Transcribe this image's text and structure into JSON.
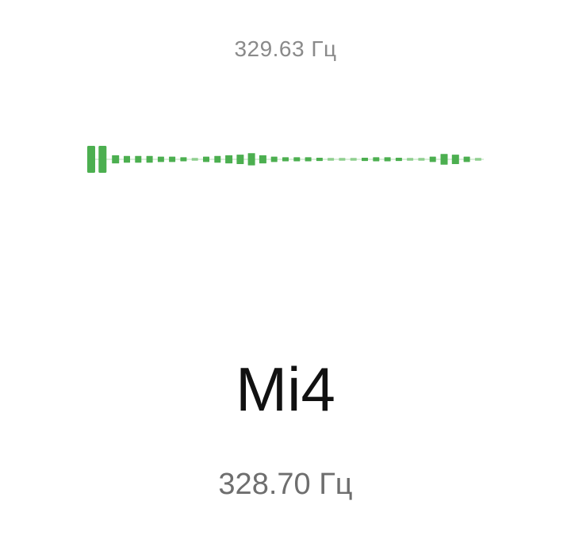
{
  "tuner": {
    "target_frequency": "329.63 Гц",
    "note": "Mi4",
    "detected_frequency": "328.70 Гц"
  },
  "meter": {
    "accent_color": "#4caf50",
    "pale_color": "#cfe8cf",
    "icon": "tuning-needle-bar-meter",
    "bars": [
      {
        "level": 1.0
      },
      {
        "level": 1.0
      },
      {
        "level": 0.3
      },
      {
        "level": 0.25
      },
      {
        "level": 0.25
      },
      {
        "level": 0.25
      },
      {
        "level": 0.2
      },
      {
        "level": 0.2
      },
      {
        "level": 0.15
      },
      {
        "level": 0.1
      },
      {
        "level": 0.2
      },
      {
        "level": 0.25
      },
      {
        "level": 0.3
      },
      {
        "level": 0.35
      },
      {
        "level": 0.45
      },
      {
        "level": 0.3
      },
      {
        "level": 0.2
      },
      {
        "level": 0.15
      },
      {
        "level": 0.15
      },
      {
        "level": 0.15
      },
      {
        "level": 0.12
      },
      {
        "level": 0.1
      },
      {
        "level": 0.1
      },
      {
        "level": 0.1
      },
      {
        "level": 0.12
      },
      {
        "level": 0.15
      },
      {
        "level": 0.15
      },
      {
        "level": 0.12
      },
      {
        "level": 0.1
      },
      {
        "level": 0.1
      },
      {
        "level": 0.2
      },
      {
        "level": 0.4
      },
      {
        "level": 0.35
      },
      {
        "level": 0.2
      },
      {
        "level": 0.1
      }
    ]
  }
}
